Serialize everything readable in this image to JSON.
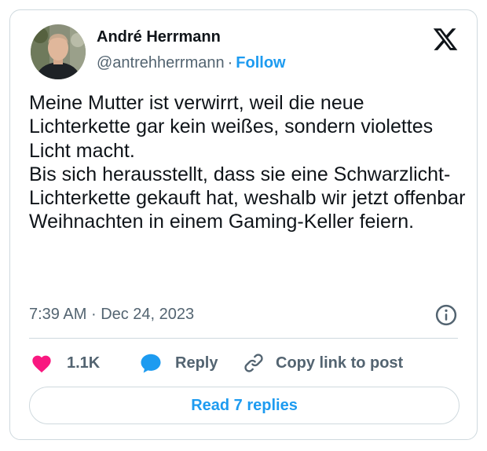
{
  "author": {
    "name": "André Herrmann",
    "handle": "@antrehherrmann",
    "separator": "·",
    "follow_label": "Follow"
  },
  "tweet": {
    "paragraphs": [
      "Meine Mutter ist verwirrt, weil die neue Lichterkette gar kein weißes, sondern violettes Licht macht.",
      "Bis sich herausstellt, dass sie eine Schwarzlicht-Lichterkette gekauft hat, weshalb wir jetzt offenbar Weihnachten in einem Gaming-Keller feiern."
    ],
    "time": "7:39 AM",
    "separator": "·",
    "date": "Dec 24, 2023"
  },
  "actions": {
    "like_count": "1.1K",
    "reply_label": "Reply",
    "copy_link_label": "Copy link to post"
  },
  "read_replies_label": "Read 7 replies",
  "icons": {
    "logo": "x-logo-icon",
    "info": "info-icon",
    "like": "heart-icon",
    "reply": "speech-bubble-icon",
    "copy": "link-icon"
  },
  "colors": {
    "accent": "#1d9bf0",
    "like": "#f91880",
    "text": "#0f1419",
    "muted": "#536471",
    "border": "#cfd9de"
  }
}
